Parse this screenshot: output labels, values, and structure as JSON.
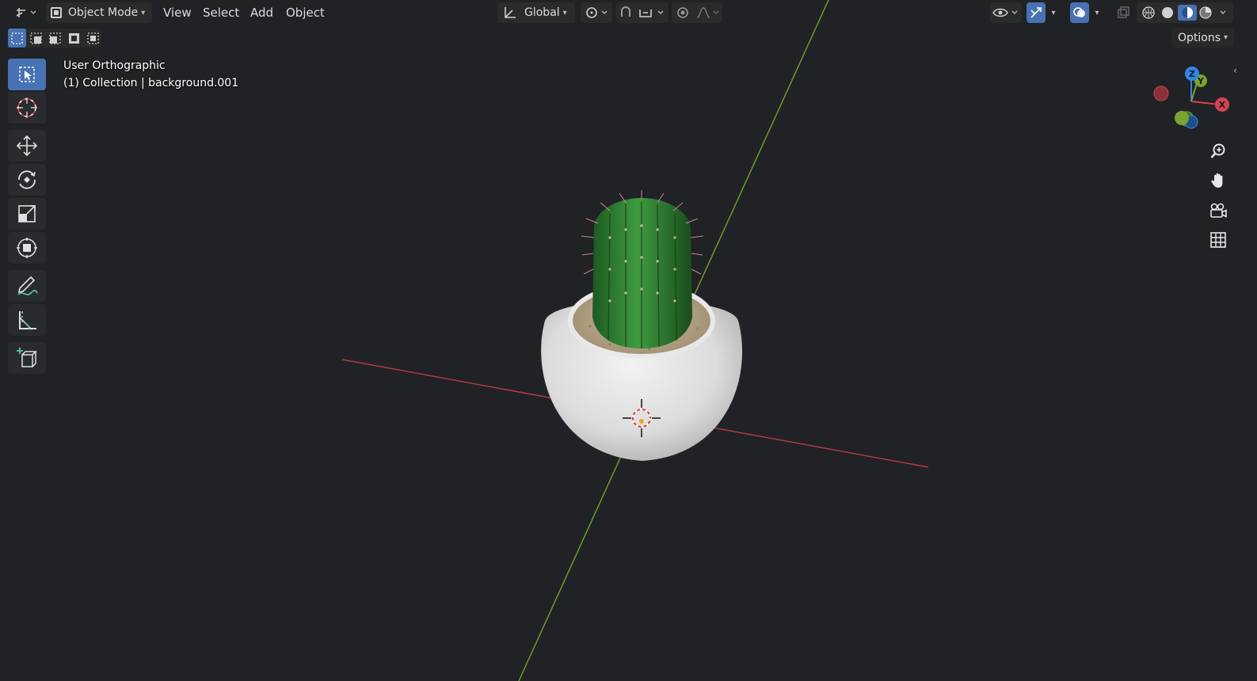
{
  "header": {
    "mode_label": "Object Mode",
    "menus": [
      "View",
      "Select",
      "Add",
      "Object"
    ],
    "transform_orientation": "Global",
    "options_label": "Options"
  },
  "viewport": {
    "view_name": "User Orthographic",
    "collection_info": "(1) Collection | background.001"
  },
  "gizmo": {
    "axis_z": "Z",
    "axis_y": "Y",
    "axis_x": "X"
  },
  "colors": {
    "accent": "#4772b3",
    "x_axis": "#d6424f",
    "y_axis": "#7aa42e",
    "z_axis": "#2f86e8",
    "background": "#202225"
  },
  "icons": {
    "editor_type": "axes-editor-icon",
    "select": "select-box-icon",
    "cursor": "cursor-icon",
    "move": "move-icon",
    "rotate": "rotate-icon",
    "scale": "scale-icon",
    "transform": "transform-icon",
    "annotate": "annotate-icon",
    "measure": "measure-icon",
    "add_cube": "add-cube-icon",
    "zoom": "zoom-icon",
    "pan": "hand-icon",
    "camera": "camera-icon",
    "grid": "grid-icon"
  }
}
